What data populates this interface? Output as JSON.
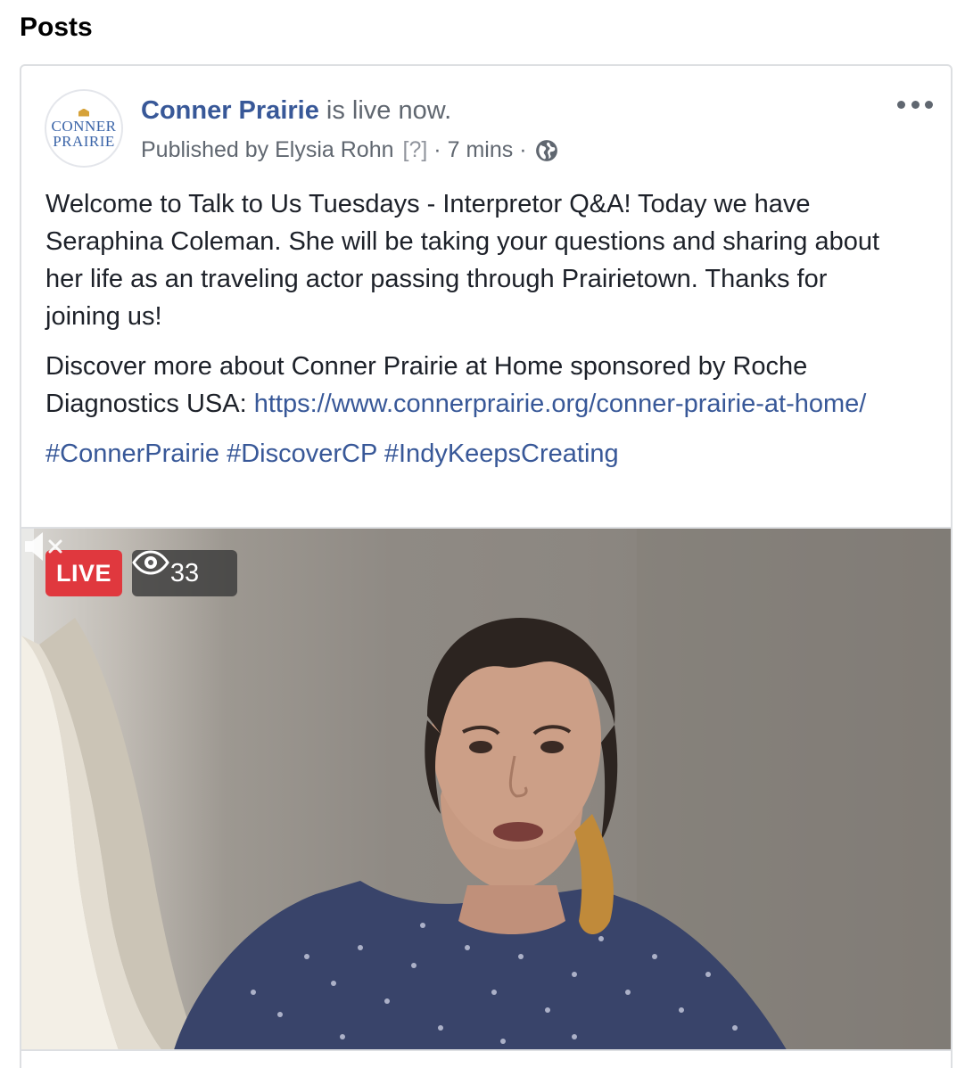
{
  "section": {
    "title": "Posts"
  },
  "post": {
    "avatar": {
      "line1": "CONNER",
      "line2": "PRAIRIE"
    },
    "page_name": "Conner Prairie",
    "status_text": " is live now.",
    "published_by": "Published by Elysia Rohn",
    "help_mark": "[?]",
    "time": "7 mins",
    "separator": "·",
    "privacy_icon": "globe-icon",
    "more_icon": "more-options-icon",
    "body": {
      "paragraph1": "Welcome to Talk to Us Tuesdays - Interpretor Q&A! Today we have Seraphina Coleman. She will be taking your questions and sharing about her life as an traveling actor passing through Prairietown. Thanks for joining us!",
      "paragraph2_text": "Discover more about Conner Prairie at Home sponsored by Roche Diagnostics USA: ",
      "paragraph2_link": "https://www.connerprairie.org/conner-prairie-at-home/",
      "hashtags": [
        "#ConnerPrairie",
        "#DiscoverCP",
        "#IndyKeepsCreating"
      ]
    },
    "video": {
      "live_label": "LIVE",
      "viewer_count": "33",
      "mute_icon": "muted-speaker-icon",
      "colors": {
        "live": "#e0383e",
        "overlay": "#3a3a3a"
      }
    }
  },
  "colors": {
    "link": "#385898",
    "meta": "#606770",
    "text": "#1d2129"
  }
}
